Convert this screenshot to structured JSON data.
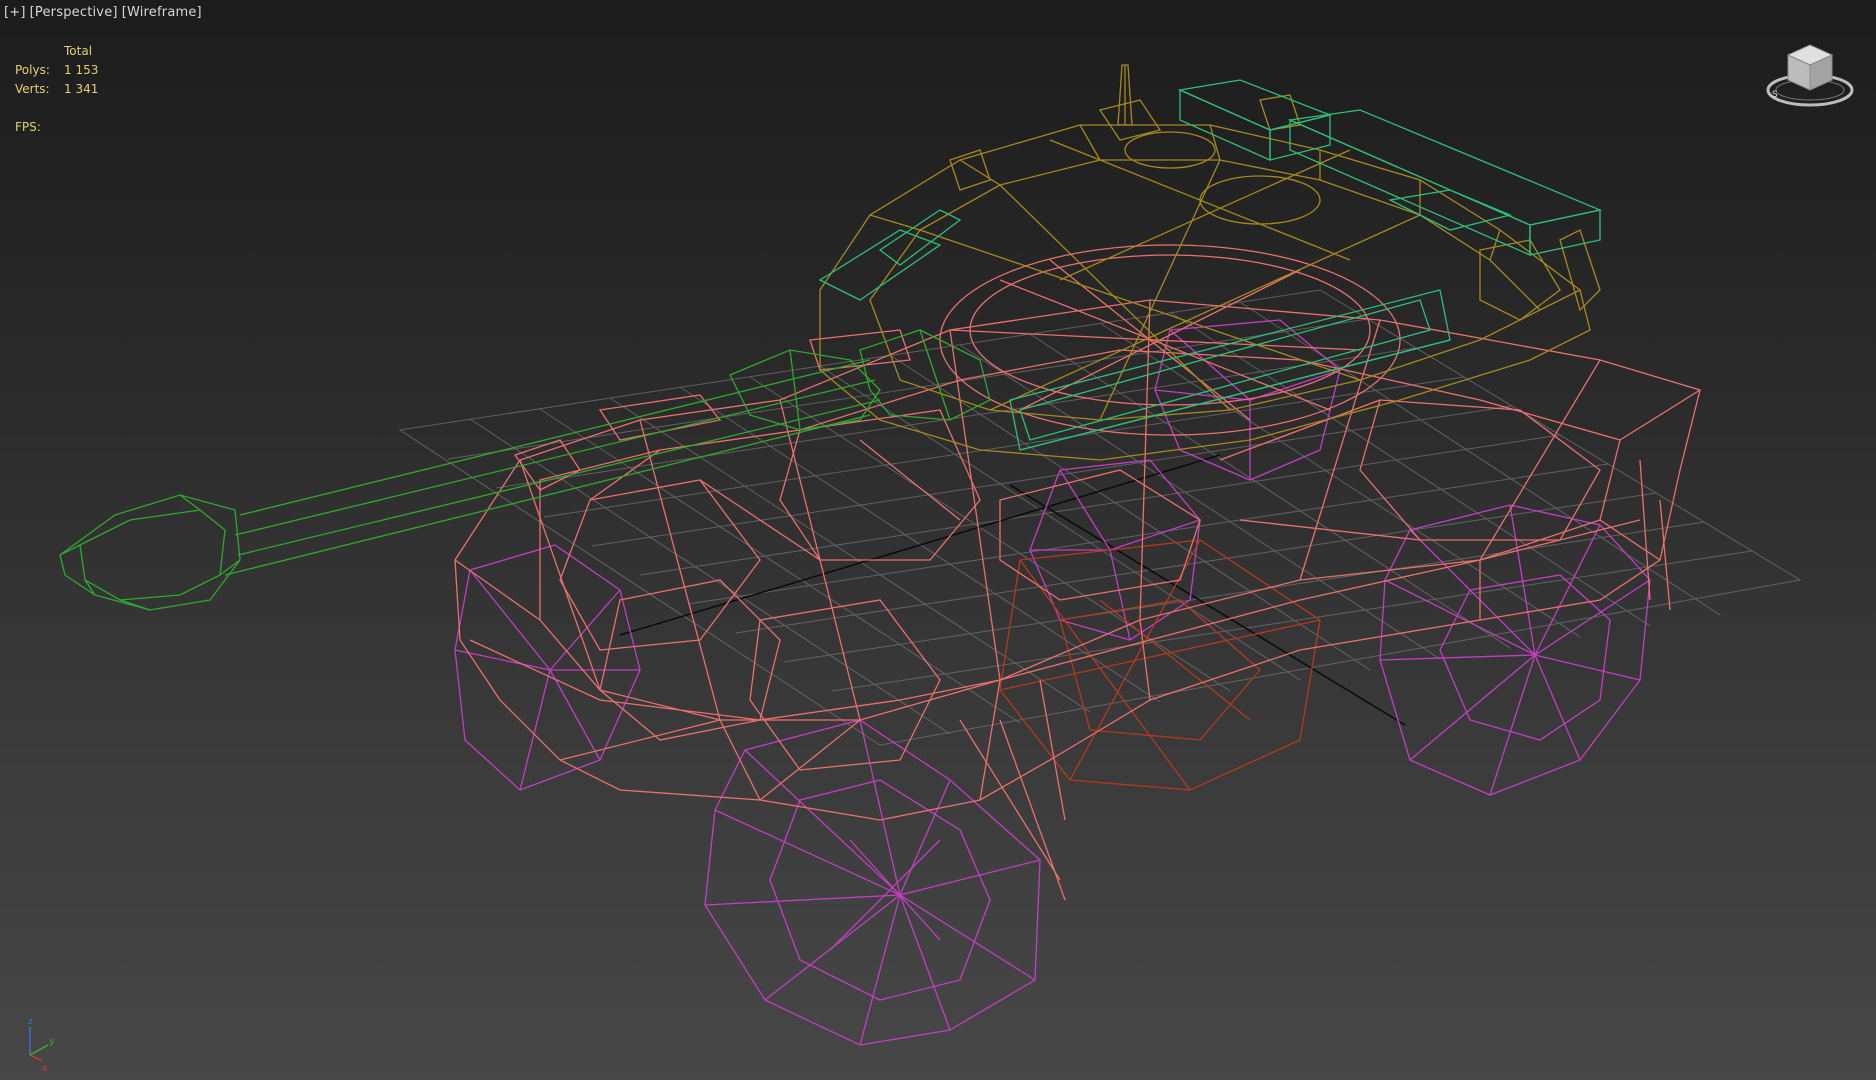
{
  "viewport": {
    "labels": [
      "[+]",
      "[Perspective]",
      "[Wireframe]"
    ]
  },
  "stats": {
    "header": "Total",
    "polys_label": "Polys:",
    "polys_value": "1 153",
    "verts_label": "Verts:",
    "verts_value": "1 341",
    "fps_label": "FPS:"
  },
  "viewcube": {
    "icon": "viewcube-icon"
  },
  "axis_gizmo": {
    "icon": "axis-tripod-icon",
    "z_label": "z",
    "y_label": "y",
    "x_label": "x"
  },
  "colors": {
    "body": "#e8716f",
    "wheels": "#c23fc2",
    "turret": "#a58a1f",
    "gun": "#2fa82f",
    "boxes": "#2fbf78",
    "tracks_inner": "#b33a1f",
    "stats_text": "#e6cf73",
    "grid": "#8a8a8a"
  }
}
